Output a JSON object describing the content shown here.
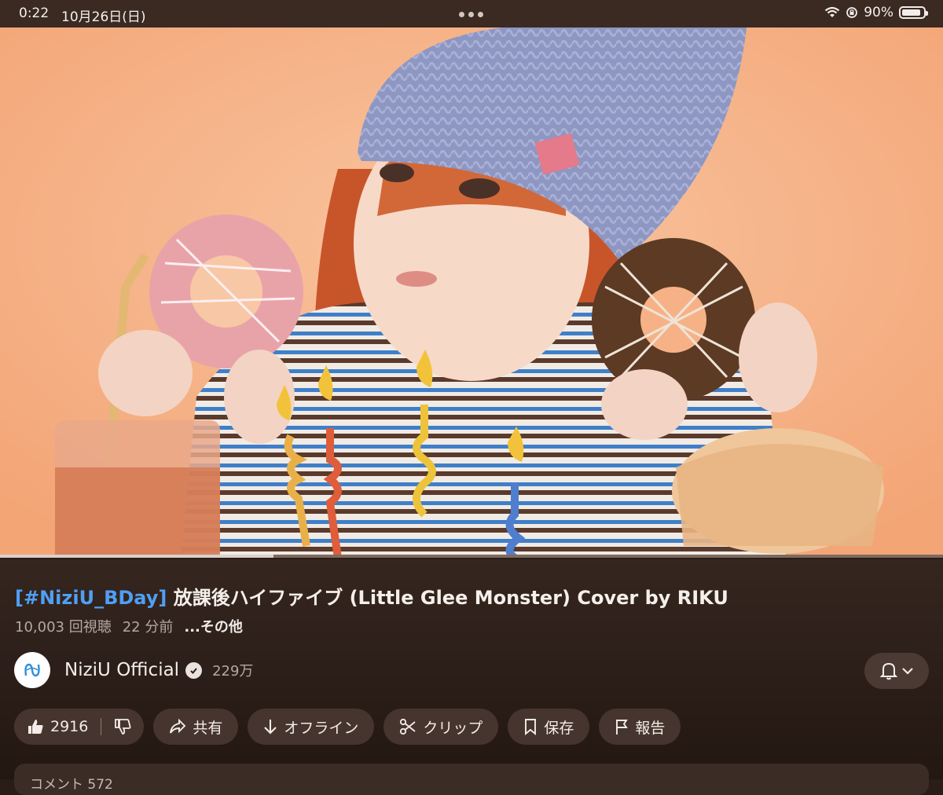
{
  "status_bar": {
    "time": "0:22",
    "date": "10月26日(日)",
    "battery": "90%",
    "battery_level": 0.9
  },
  "video": {
    "progress": 0.29
  },
  "title": {
    "hashtag": "[#NiziU_BDay]",
    "rest": " 放課後ハイファイブ (Little Glee Monster) Cover by RIKU"
  },
  "meta": {
    "views": "10,003 回視聴",
    "time_ago": "22 分前",
    "more": "...その他"
  },
  "channel": {
    "name": "NiziU Official",
    "subscribers": "229万"
  },
  "actions": {
    "likes": "2916",
    "share": "共有",
    "offline": "オフライン",
    "clip": "クリップ",
    "save": "保存",
    "report": "報告"
  },
  "comments": {
    "label": "コメント 572"
  }
}
